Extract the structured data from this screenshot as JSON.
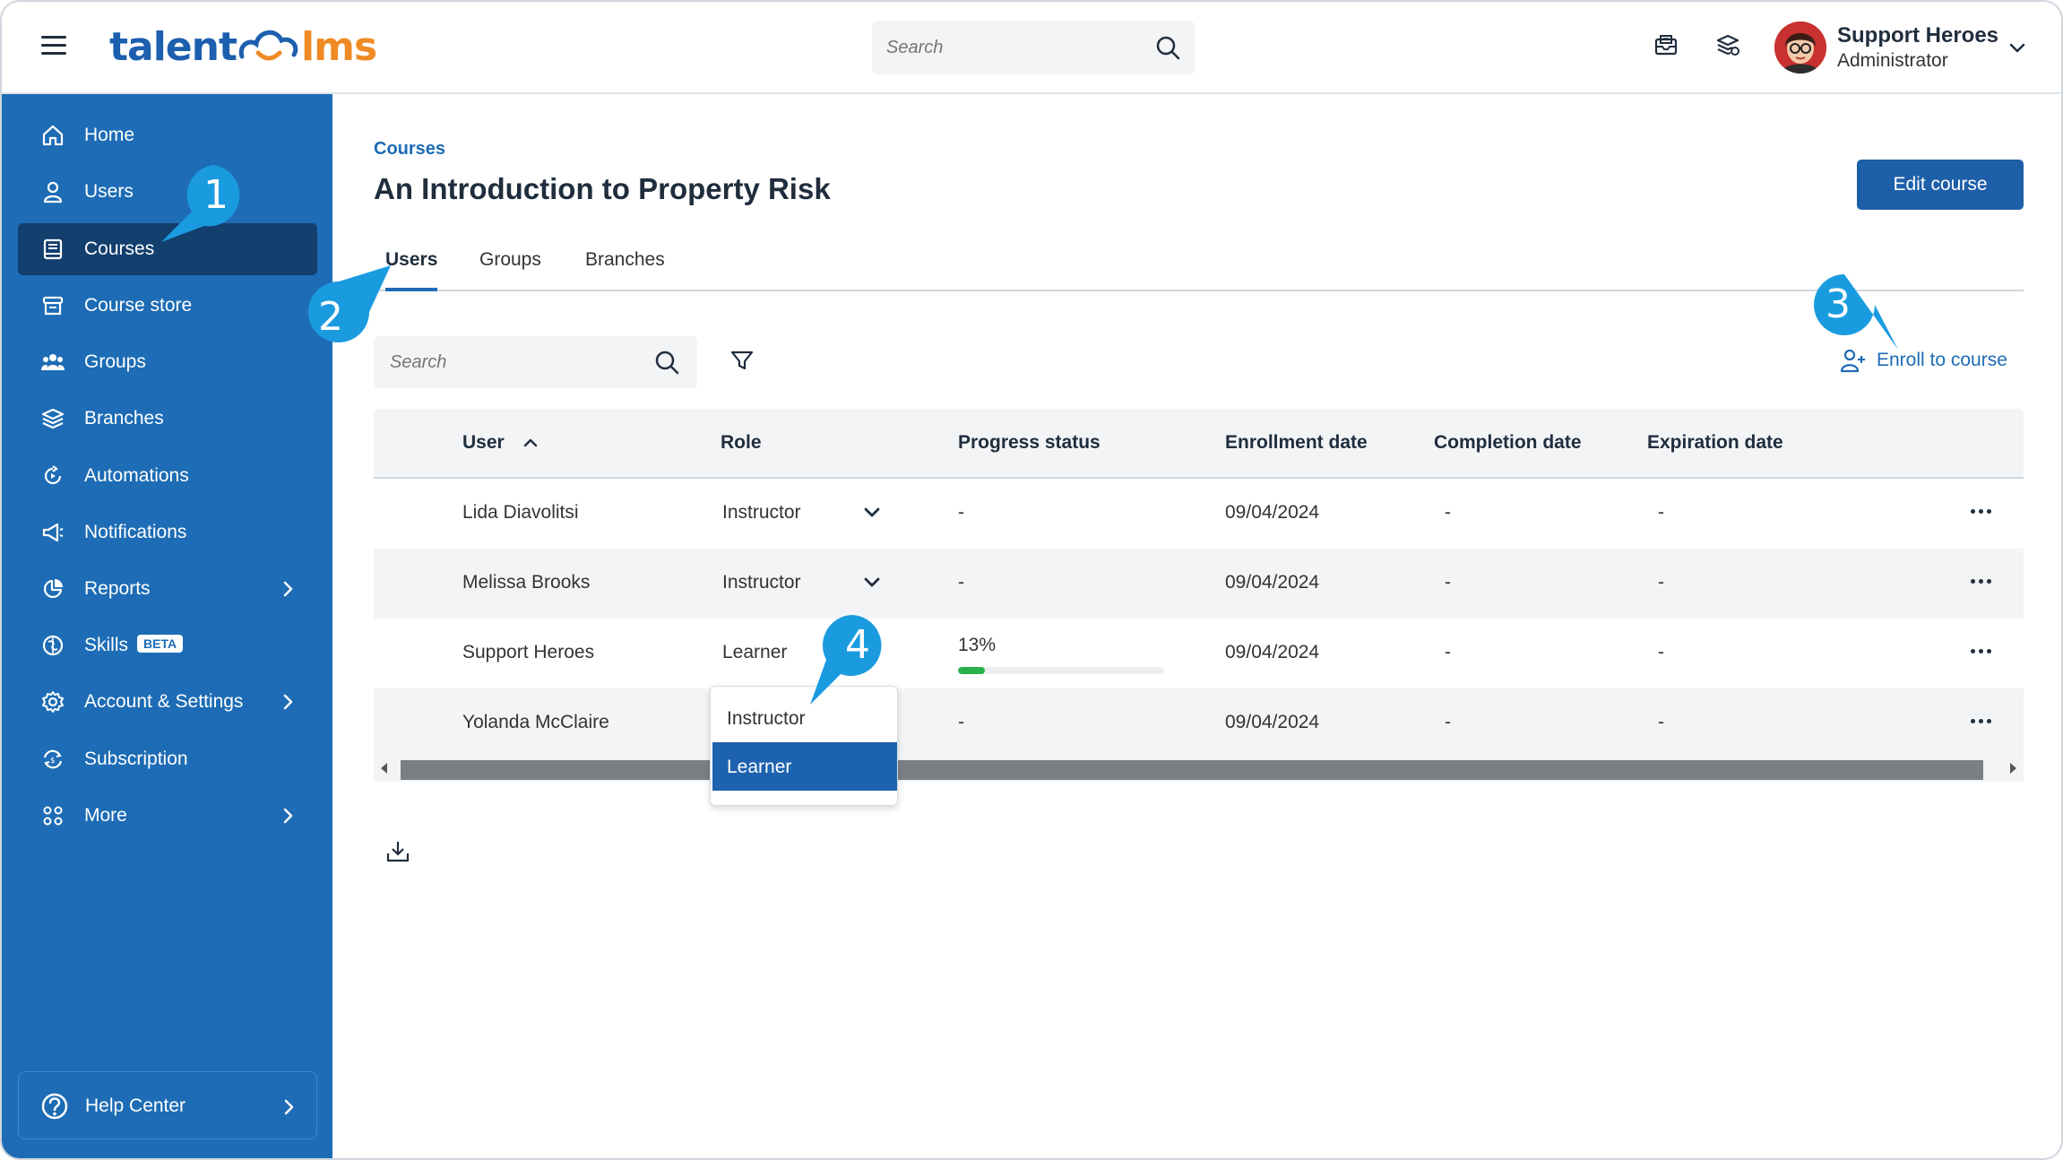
{
  "header": {
    "logo": {
      "part1": "talent",
      "part2": "lms"
    },
    "search_placeholder": "Search",
    "user": {
      "name": "Support Heroes",
      "role": "Administrator"
    }
  },
  "sidebar": {
    "items": [
      {
        "label": "Home",
        "icon": "home-icon"
      },
      {
        "label": "Users",
        "icon": "user-icon"
      },
      {
        "label": "Courses",
        "icon": "book-icon",
        "active": true
      },
      {
        "label": "Course store",
        "icon": "store-icon"
      },
      {
        "label": "Groups",
        "icon": "groups-icon"
      },
      {
        "label": "Branches",
        "icon": "layers-icon"
      },
      {
        "label": "Automations",
        "icon": "automation-icon"
      },
      {
        "label": "Notifications",
        "icon": "megaphone-icon"
      },
      {
        "label": "Reports",
        "icon": "pie-chart-icon",
        "has_submenu": true
      },
      {
        "label": "Skills",
        "icon": "skills-icon",
        "badge": "BETA"
      },
      {
        "label": "Account & Settings",
        "icon": "gear-icon",
        "has_submenu": true
      },
      {
        "label": "Subscription",
        "icon": "subscription-icon"
      },
      {
        "label": "More",
        "icon": "grid-icon",
        "has_submenu": true
      }
    ],
    "help": {
      "label": "Help Center",
      "icon": "help-icon"
    }
  },
  "main": {
    "breadcrumb": "Courses",
    "title": "An Introduction to Property Risk",
    "edit_button": "Edit course",
    "tabs": [
      {
        "label": "Users",
        "active": true
      },
      {
        "label": "Groups"
      },
      {
        "label": "Branches"
      }
    ],
    "search_placeholder": "Search",
    "enroll_label": "Enroll to course"
  },
  "table": {
    "columns": [
      "User",
      "Role",
      "Progress status",
      "Enrollment date",
      "Completion date",
      "Expiration date"
    ],
    "rows": [
      {
        "user": "Lida Diavolitsi",
        "role": "Instructor",
        "progress": "-",
        "enrollment": "09/04/2024",
        "completion": "-",
        "expiration": "-"
      },
      {
        "user": "Melissa Brooks",
        "role": "Instructor",
        "progress": "-",
        "enrollment": "09/04/2024",
        "completion": "-",
        "expiration": "-"
      },
      {
        "user": "Support Heroes",
        "role": "Learner",
        "progress": "13%",
        "progress_value": 0.13,
        "enrollment": "09/04/2024",
        "completion": "-",
        "expiration": "-"
      },
      {
        "user": "Yolanda McClaire",
        "role": "",
        "progress": "-",
        "enrollment": "09/04/2024",
        "completion": "-",
        "expiration": "-"
      }
    ],
    "role_dropdown": {
      "options": [
        "Instructor",
        "Learner"
      ],
      "selected": "Learner"
    }
  },
  "callouts": [
    "1",
    "2",
    "3",
    "4"
  ],
  "colors": {
    "sidebar": "#1d6cb5",
    "active_nav": "#123f6e",
    "accent": "#1d6cb5",
    "callout": "#1a9be0",
    "progress": "#2ab14a",
    "logo_orange": "#f08a24"
  }
}
